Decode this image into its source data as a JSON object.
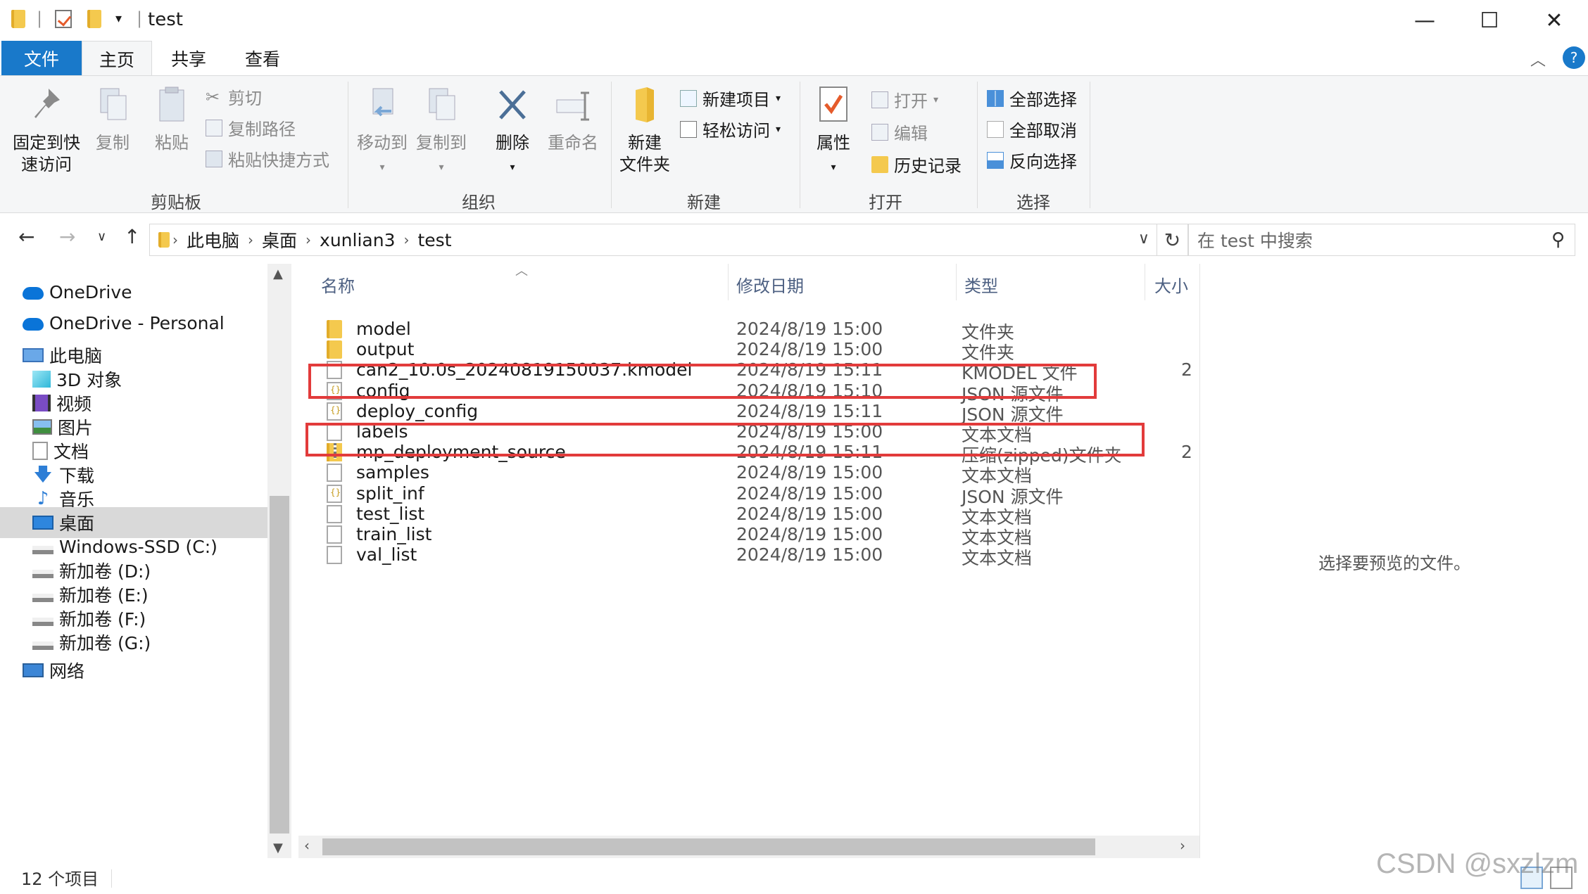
{
  "window": {
    "title": "test",
    "minimize": "—",
    "maximize": "☐",
    "close": "✕"
  },
  "ribbon": {
    "tabs": [
      "文件",
      "主页",
      "共享",
      "查看"
    ],
    "help": "?",
    "clipboard": {
      "pin": "固定到快\n速访问",
      "pin_line1": "固定到快",
      "pin_line2": "速访问",
      "copy": "复制",
      "paste": "粘贴",
      "cut": "剪切",
      "copy_path": "复制路径",
      "paste_shortcut": "粘贴快捷方式",
      "label": "剪贴板"
    },
    "organize": {
      "move_to": "移动到",
      "copy_to": "复制到",
      "delete": "删除",
      "rename": "重命名",
      "label": "组织"
    },
    "new": {
      "new_folder_line1": "新建",
      "new_folder_line2": "文件夹",
      "new_item": "新建项目",
      "easy_access": "轻松访问",
      "label": "新建"
    },
    "open": {
      "properties": "属性",
      "open": "打开",
      "edit": "编辑",
      "history": "历史记录",
      "label": "打开"
    },
    "select": {
      "select_all": "全部选择",
      "select_none": "全部取消",
      "invert": "反向选择",
      "label": "选择"
    }
  },
  "address": {
    "crumbs": [
      "此电脑",
      "桌面",
      "xunlian3",
      "test"
    ],
    "search_placeholder": "在 test 中搜索"
  },
  "nav": {
    "items": [
      {
        "label": "OneDrive",
        "icon": "cloud-icon"
      },
      {
        "label": "OneDrive - Personal",
        "icon": "cloud-icon"
      },
      {
        "label": "此电脑",
        "icon": "computer-icon"
      },
      {
        "label": "3D 对象",
        "icon": "cube-icon"
      },
      {
        "label": "视频",
        "icon": "video-icon"
      },
      {
        "label": "图片",
        "icon": "picture-icon"
      },
      {
        "label": "文档",
        "icon": "document-icon"
      },
      {
        "label": "下载",
        "icon": "download-icon"
      },
      {
        "label": "音乐",
        "icon": "music-icon"
      },
      {
        "label": "桌面",
        "icon": "desktop-icon"
      },
      {
        "label": "Windows-SSD (C:)",
        "icon": "drive-icon"
      },
      {
        "label": "新加卷 (D:)",
        "icon": "drive-icon"
      },
      {
        "label": "新加卷 (E:)",
        "icon": "drive-icon"
      },
      {
        "label": "新加卷 (F:)",
        "icon": "drive-icon"
      },
      {
        "label": "新加卷 (G:)",
        "icon": "drive-icon"
      },
      {
        "label": "网络",
        "icon": "network-icon"
      }
    ]
  },
  "files": {
    "columns": [
      "名称",
      "修改日期",
      "类型",
      "大小"
    ],
    "rows": [
      {
        "name": "model",
        "date": "2024/8/19 15:00",
        "type": "文件夹",
        "size": "",
        "icon": "folder"
      },
      {
        "name": "output",
        "date": "2024/8/19 15:00",
        "type": "文件夹",
        "size": "",
        "icon": "folder"
      },
      {
        "name": "can2_10.0s_20240819150037.kmodel",
        "date": "2024/8/19 15:11",
        "type": "KMODEL 文件",
        "size": "2",
        "icon": "file"
      },
      {
        "name": "config",
        "date": "2024/8/19 15:10",
        "type": "JSON 源文件",
        "size": "",
        "icon": "json"
      },
      {
        "name": "deploy_config",
        "date": "2024/8/19 15:11",
        "type": "JSON 源文件",
        "size": "",
        "icon": "json"
      },
      {
        "name": "labels",
        "date": "2024/8/19 15:00",
        "type": "文本文档",
        "size": "",
        "icon": "file"
      },
      {
        "name": "mp_deployment_source",
        "date": "2024/8/19 15:11",
        "type": "压缩(zipped)文件夹",
        "size": "2",
        "icon": "zip"
      },
      {
        "name": "samples",
        "date": "2024/8/19 15:00",
        "type": "文本文档",
        "size": "",
        "icon": "file"
      },
      {
        "name": "split_inf",
        "date": "2024/8/19 15:00",
        "type": "JSON 源文件",
        "size": "",
        "icon": "json"
      },
      {
        "name": "test_list",
        "date": "2024/8/19 15:00",
        "type": "文本文档",
        "size": "",
        "icon": "file"
      },
      {
        "name": "train_list",
        "date": "2024/8/19 15:00",
        "type": "文本文档",
        "size": "",
        "icon": "file"
      },
      {
        "name": "val_list",
        "date": "2024/8/19 15:00",
        "type": "文本文档",
        "size": "",
        "icon": "file"
      }
    ]
  },
  "preview": {
    "message": "选择要预览的文件。"
  },
  "status": {
    "count": "12 个项目"
  },
  "watermark": "CSDN @sxzlzm",
  "colors": {
    "accent": "#1979ca",
    "highlight": "#e23b3b",
    "selected_nav": "#d9d9d9"
  }
}
